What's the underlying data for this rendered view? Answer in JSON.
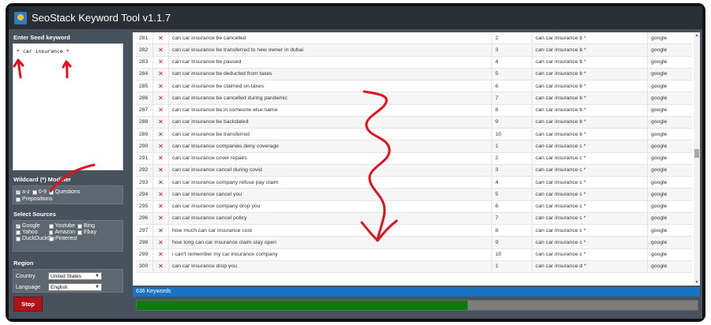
{
  "window": {
    "title": "SeoStack Keyword Tool v1.1.7"
  },
  "sidebar": {
    "seed_label": "Enter Seed keyword",
    "seed_value": "* car insurance *",
    "wildcard_label": "Wildcard (*) Modifier",
    "wildcard_options": [
      {
        "label": "a-z",
        "checked": true
      },
      {
        "label": "0-9",
        "checked": false
      },
      {
        "label": "Questions",
        "checked": true
      },
      {
        "label": "Prepositions",
        "checked": false
      }
    ],
    "sources_label": "Select Sources",
    "sources": [
      {
        "label": "Google",
        "checked": true
      },
      {
        "label": "Youtube",
        "checked": false
      },
      {
        "label": "Bing",
        "checked": false
      },
      {
        "label": "Yahoo",
        "checked": false
      },
      {
        "label": "Amazon",
        "checked": false
      },
      {
        "label": "Ebay",
        "checked": false
      },
      {
        "label": "DuckDuckGo",
        "checked": false
      },
      {
        "label": "Pinterest",
        "checked": false
      }
    ],
    "region_label": "Region",
    "country_label": "Country",
    "country_value": "United States",
    "language_label": "Language",
    "language_value": "English",
    "stop_label": "Stop"
  },
  "results": {
    "delete_glyph": "✕",
    "rows": [
      {
        "num": "281",
        "keyword": "can car insurance be cancelled",
        "pos": "2",
        "seed": "can car insurance b *",
        "source": "google"
      },
      {
        "num": "282",
        "keyword": "can car insurance be transferred to new owner in dubai",
        "pos": "3",
        "seed": "can car insurance b *",
        "source": "google"
      },
      {
        "num": "283",
        "keyword": "can car insurance be paused",
        "pos": "4",
        "seed": "can car insurance b *",
        "source": "google"
      },
      {
        "num": "284",
        "keyword": "can car insurance be deducted from taxes",
        "pos": "5",
        "seed": "can car insurance b *",
        "source": "google"
      },
      {
        "num": "285",
        "keyword": "can car insurance be claimed on taxes",
        "pos": "6",
        "seed": "can car insurance b *",
        "source": "google"
      },
      {
        "num": "286",
        "keyword": "can car insurance be cancelled during pandemic",
        "pos": "7",
        "seed": "can car insurance b *",
        "source": "google"
      },
      {
        "num": "287",
        "keyword": "can car insurance be in someone else name",
        "pos": "8",
        "seed": "can car insurance b *",
        "source": "google"
      },
      {
        "num": "288",
        "keyword": "can car insurance be backdated",
        "pos": "9",
        "seed": "can car insurance b *",
        "source": "google"
      },
      {
        "num": "289",
        "keyword": "can car insurance be transferred",
        "pos": "10",
        "seed": "can car insurance b *",
        "source": "google"
      },
      {
        "num": "290",
        "keyword": "can car insurance companies deny coverage",
        "pos": "1",
        "seed": "can car insurance c *",
        "source": "google"
      },
      {
        "num": "291",
        "keyword": "can car insurance cover repairs",
        "pos": "2",
        "seed": "can car insurance c *",
        "source": "google"
      },
      {
        "num": "292",
        "keyword": "can car insurance cancel during covid",
        "pos": "3",
        "seed": "can car insurance c *",
        "source": "google"
      },
      {
        "num": "293",
        "keyword": "can car insurance company refuse pay claim",
        "pos": "4",
        "seed": "can car insurance c *",
        "source": "google"
      },
      {
        "num": "294",
        "keyword": "can car insurance cancel you",
        "pos": "5",
        "seed": "can car insurance c *",
        "source": "google"
      },
      {
        "num": "295",
        "keyword": "can car insurance company drop you",
        "pos": "6",
        "seed": "can car insurance c *",
        "source": "google"
      },
      {
        "num": "296",
        "keyword": "can car insurance cancel policy",
        "pos": "7",
        "seed": "can car insurance c *",
        "source": "google"
      },
      {
        "num": "297",
        "keyword": "how much can car insurance cost",
        "pos": "8",
        "seed": "can car insurance c *",
        "source": "google"
      },
      {
        "num": "298",
        "keyword": "how long can car insurance claim stay open",
        "pos": "9",
        "seed": "can car insurance c *",
        "source": "google"
      },
      {
        "num": "299",
        "keyword": "i can't remember my car insurance company",
        "pos": "10",
        "seed": "can car insurance c *",
        "source": "google"
      },
      {
        "num": "300",
        "keyword": "can car insurance drop you",
        "pos": "1",
        "seed": "can car insurance d *",
        "source": "google"
      }
    ]
  },
  "status": {
    "keyword_count": "636 Keywords"
  },
  "progress": {
    "fraction": 0.59
  },
  "colors": {
    "annotation": "#e0121c",
    "progress": "#0a7d11",
    "status": "#1a73c2"
  }
}
